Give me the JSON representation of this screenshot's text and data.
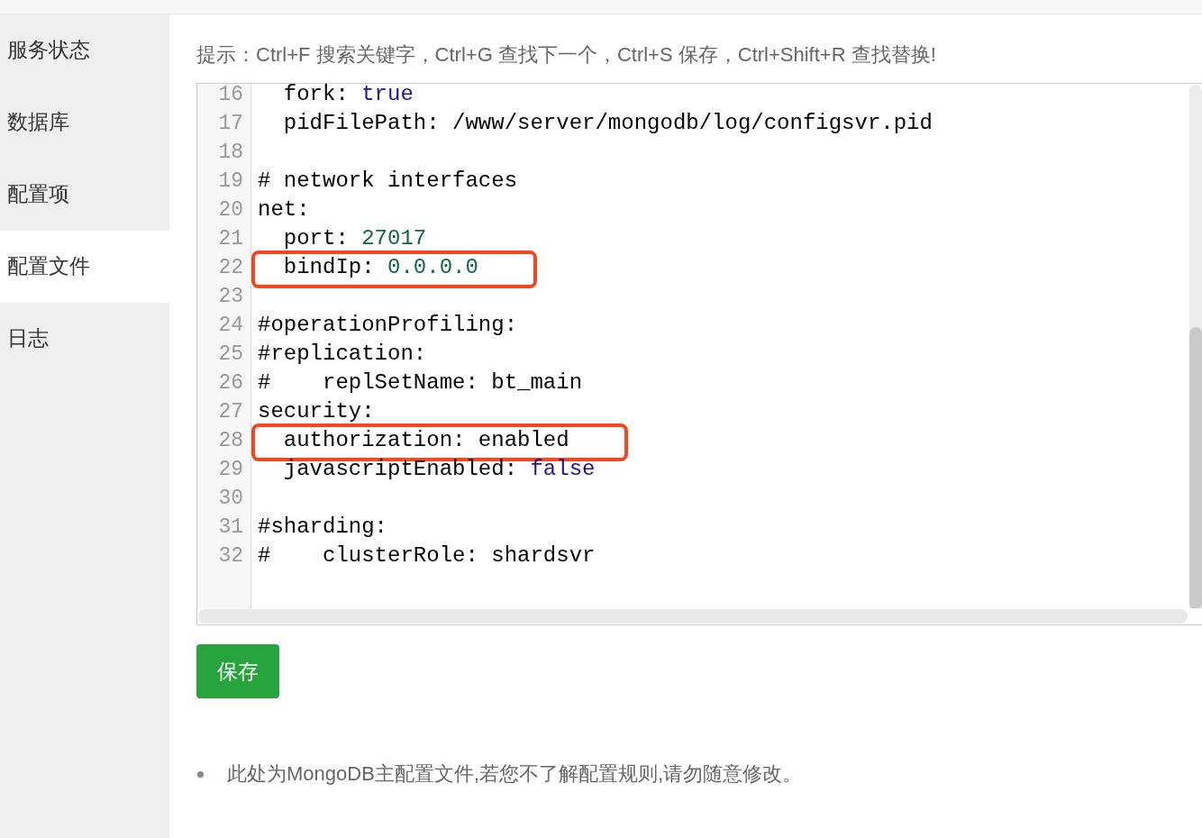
{
  "sidebar": {
    "items": [
      {
        "label": "服务状态",
        "selected": false
      },
      {
        "label": "数据库",
        "selected": false
      },
      {
        "label": "配置项",
        "selected": false
      },
      {
        "label": "配置文件",
        "selected": true
      },
      {
        "label": "日志",
        "selected": false
      }
    ]
  },
  "hint": "提示：Ctrl+F 搜索关键字，Ctrl+G 查找下一个，Ctrl+S 保存，Ctrl+Shift+R 查找替换!",
  "editor": {
    "lines": [
      {
        "number": "16",
        "highlighted": false,
        "tokens": [
          {
            "text": "  fork: ",
            "kind": "plain"
          },
          {
            "text": "true",
            "kind": "keyword"
          }
        ]
      },
      {
        "number": "17",
        "highlighted": false,
        "tokens": [
          {
            "text": "  pidFilePath: /www/server/mongodb/log/configsvr.pid",
            "kind": "plain"
          }
        ]
      },
      {
        "number": "18",
        "highlighted": false
      },
      {
        "number": "19",
        "highlighted": false,
        "tokens": [
          {
            "text": "# network interfaces",
            "kind": "plain"
          }
        ]
      },
      {
        "number": "20",
        "highlighted": false,
        "tokens": [
          {
            "text": "net:",
            "kind": "plain"
          }
        ]
      },
      {
        "number": "21",
        "highlighted": false,
        "tokens": [
          {
            "text": "  port: ",
            "kind": "plain"
          },
          {
            "text": "27017",
            "kind": "number"
          }
        ]
      },
      {
        "number": "22",
        "highlighted": true,
        "tokens": [
          {
            "text": "  bindIp: ",
            "kind": "plain"
          },
          {
            "text": "0.0.0.0",
            "kind": "number"
          }
        ]
      },
      {
        "number": "23",
        "highlighted": false
      },
      {
        "number": "24",
        "highlighted": false,
        "tokens": [
          {
            "text": "#operationProfiling:",
            "kind": "plain"
          }
        ]
      },
      {
        "number": "25",
        "highlighted": false,
        "tokens": [
          {
            "text": "#replication:",
            "kind": "plain"
          }
        ]
      },
      {
        "number": "26",
        "highlighted": false,
        "tokens": [
          {
            "text": "#    replSetName: bt_main",
            "kind": "plain"
          }
        ]
      },
      {
        "number": "27",
        "highlighted": false,
        "tokens": [
          {
            "text": "security:",
            "kind": "plain"
          }
        ]
      },
      {
        "number": "28",
        "highlighted": true,
        "tokens": [
          {
            "text": "  authorization: enabled",
            "kind": "plain"
          }
        ]
      },
      {
        "number": "29",
        "highlighted": false,
        "tokens": [
          {
            "text": "  javascriptEnabled: ",
            "kind": "plain"
          },
          {
            "text": "false",
            "kind": "keyword"
          }
        ]
      },
      {
        "number": "30",
        "highlighted": false
      },
      {
        "number": "31",
        "highlighted": false,
        "tokens": [
          {
            "text": "#sharding:",
            "kind": "plain"
          }
        ]
      },
      {
        "number": "32",
        "highlighted": false,
        "tokens": [
          {
            "text": "#    clusterRole: shardsvr",
            "kind": "plain"
          }
        ]
      }
    ]
  },
  "save_button": "保存",
  "notes": [
    "此处为MongoDB主配置文件,若您不了解配置规则,请勿随意修改。"
  ]
}
